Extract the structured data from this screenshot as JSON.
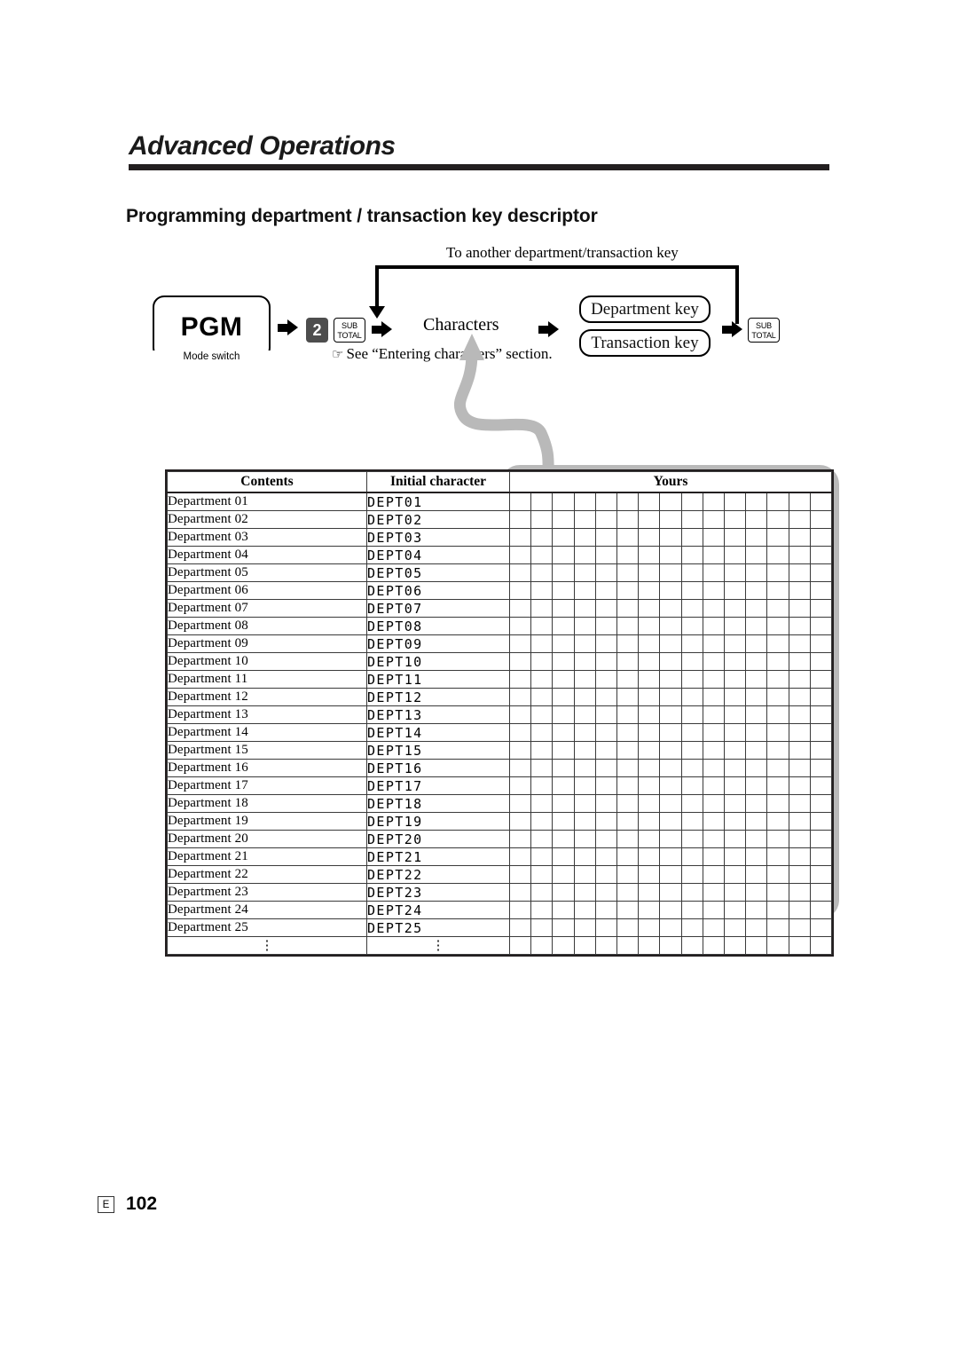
{
  "page": {
    "chapter_title": "Advanced Operations",
    "section_heading": "Programming department / transaction key descriptor",
    "language_mark": "E",
    "page_number": "102"
  },
  "flow": {
    "loop_label": "To another department/transaction key",
    "mode_switch_value": "PGM",
    "mode_switch_caption": "Mode switch",
    "numeric_key": "2",
    "subtotal_key_line1": "SUB",
    "subtotal_key_line2": "TOTAL",
    "characters_label": "Characters",
    "see_note_icon": "pointing-hand",
    "see_note": "See “Entering characters” section.",
    "department_key": "Department key",
    "transaction_key": "Transaction key",
    "final_subtotal_line1": "SUB",
    "final_subtotal_line2": "TOTAL"
  },
  "table": {
    "columns": [
      "Contents",
      "Initial character",
      "Yours"
    ],
    "yours_cell_count": 15,
    "ellipsis": "⋮",
    "rows": [
      {
        "contents": "Department 01",
        "initial": "DEPT01"
      },
      {
        "contents": "Department 02",
        "initial": "DEPT02"
      },
      {
        "contents": "Department 03",
        "initial": "DEPT03"
      },
      {
        "contents": "Department 04",
        "initial": "DEPT04"
      },
      {
        "contents": "Department 05",
        "initial": "DEPT05"
      },
      {
        "contents": "Department 06",
        "initial": "DEPT06"
      },
      {
        "contents": "Department 07",
        "initial": "DEPT07"
      },
      {
        "contents": "Department 08",
        "initial": "DEPT08"
      },
      {
        "contents": "Department 09",
        "initial": "DEPT09"
      },
      {
        "contents": "Department 10",
        "initial": "DEPT10"
      },
      {
        "contents": "Department 11",
        "initial": "DEPT11"
      },
      {
        "contents": "Department 12",
        "initial": "DEPT12"
      },
      {
        "contents": "Department 13",
        "initial": "DEPT13"
      },
      {
        "contents": "Department 14",
        "initial": "DEPT14"
      },
      {
        "contents": "Department 15",
        "initial": "DEPT15"
      },
      {
        "contents": "Department 16",
        "initial": "DEPT16"
      },
      {
        "contents": "Department 17",
        "initial": "DEPT17"
      },
      {
        "contents": "Department 18",
        "initial": "DEPT18"
      },
      {
        "contents": "Department 19",
        "initial": "DEPT19"
      },
      {
        "contents": "Department 20",
        "initial": "DEPT20"
      },
      {
        "contents": "Department 21",
        "initial": "DEPT21"
      },
      {
        "contents": "Department 22",
        "initial": "DEPT22"
      },
      {
        "contents": "Department 23",
        "initial": "DEPT23"
      },
      {
        "contents": "Department 24",
        "initial": "DEPT24"
      },
      {
        "contents": "Department 25",
        "initial": "DEPT25"
      }
    ]
  },
  "colors": {
    "ink": "#231f20",
    "rule": "#3a3a3a",
    "key_dark": "#4d4d4d",
    "gray_arrow": "#b9b9b9"
  }
}
